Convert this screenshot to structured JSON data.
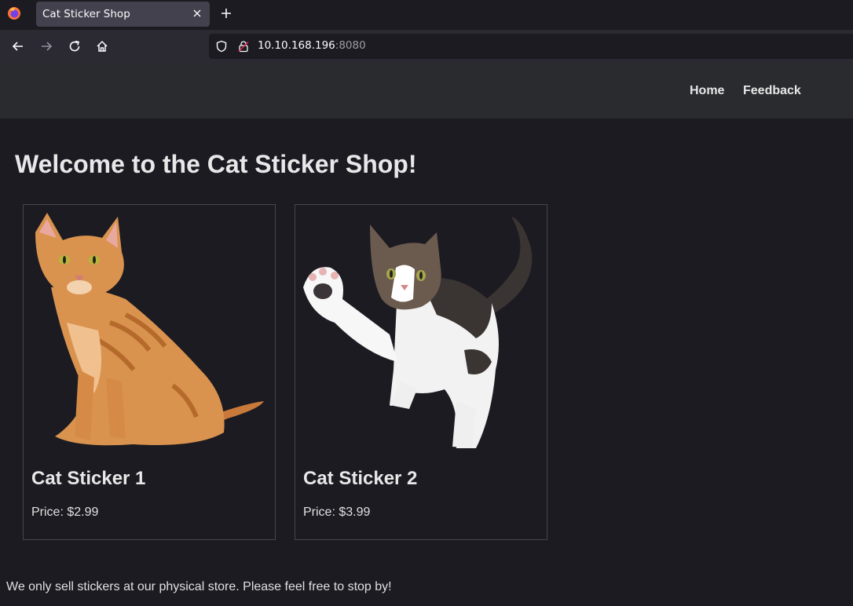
{
  "browser": {
    "tab_title": "Cat Sticker Shop",
    "url_host": "10.10.168.196",
    "url_port": ":8080"
  },
  "nav": {
    "home": "Home",
    "feedback": "Feedback"
  },
  "page": {
    "title": "Welcome to the Cat Sticker Shop!",
    "footer": "We only sell stickers at our physical store. Please feel free to stop by!"
  },
  "products": [
    {
      "name": "Cat Sticker 1",
      "price": "Price: $2.99"
    },
    {
      "name": "Cat Sticker 2",
      "price": "Price: $3.99"
    }
  ]
}
